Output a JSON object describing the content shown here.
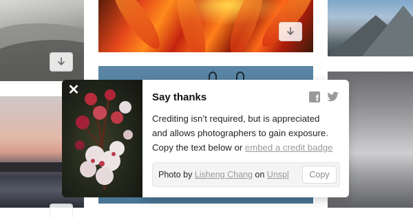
{
  "modal": {
    "title": "Say thanks",
    "body_line1": "Crediting isn’t required, but is appreciated",
    "body_line2": "and allows photographers to gain exposure.",
    "body_line3_prefix": "Copy the text below or ",
    "body_link": "embed a credit badge",
    "close_label": "✕",
    "social": {
      "facebook_icon": "facebook-icon",
      "twitter_icon": "twitter-icon"
    },
    "credit": {
      "prefix": "Photo by ",
      "author": "Lisheng Chang",
      "middle": " on ",
      "source": "Unspl",
      "copy_label": "Copy"
    }
  },
  "background": {
    "download_icon": "download-arrow-icon",
    "caption_partial": "...",
    "colors": {
      "overlay_dark": "#22261a",
      "link_gray": "#999999"
    }
  }
}
